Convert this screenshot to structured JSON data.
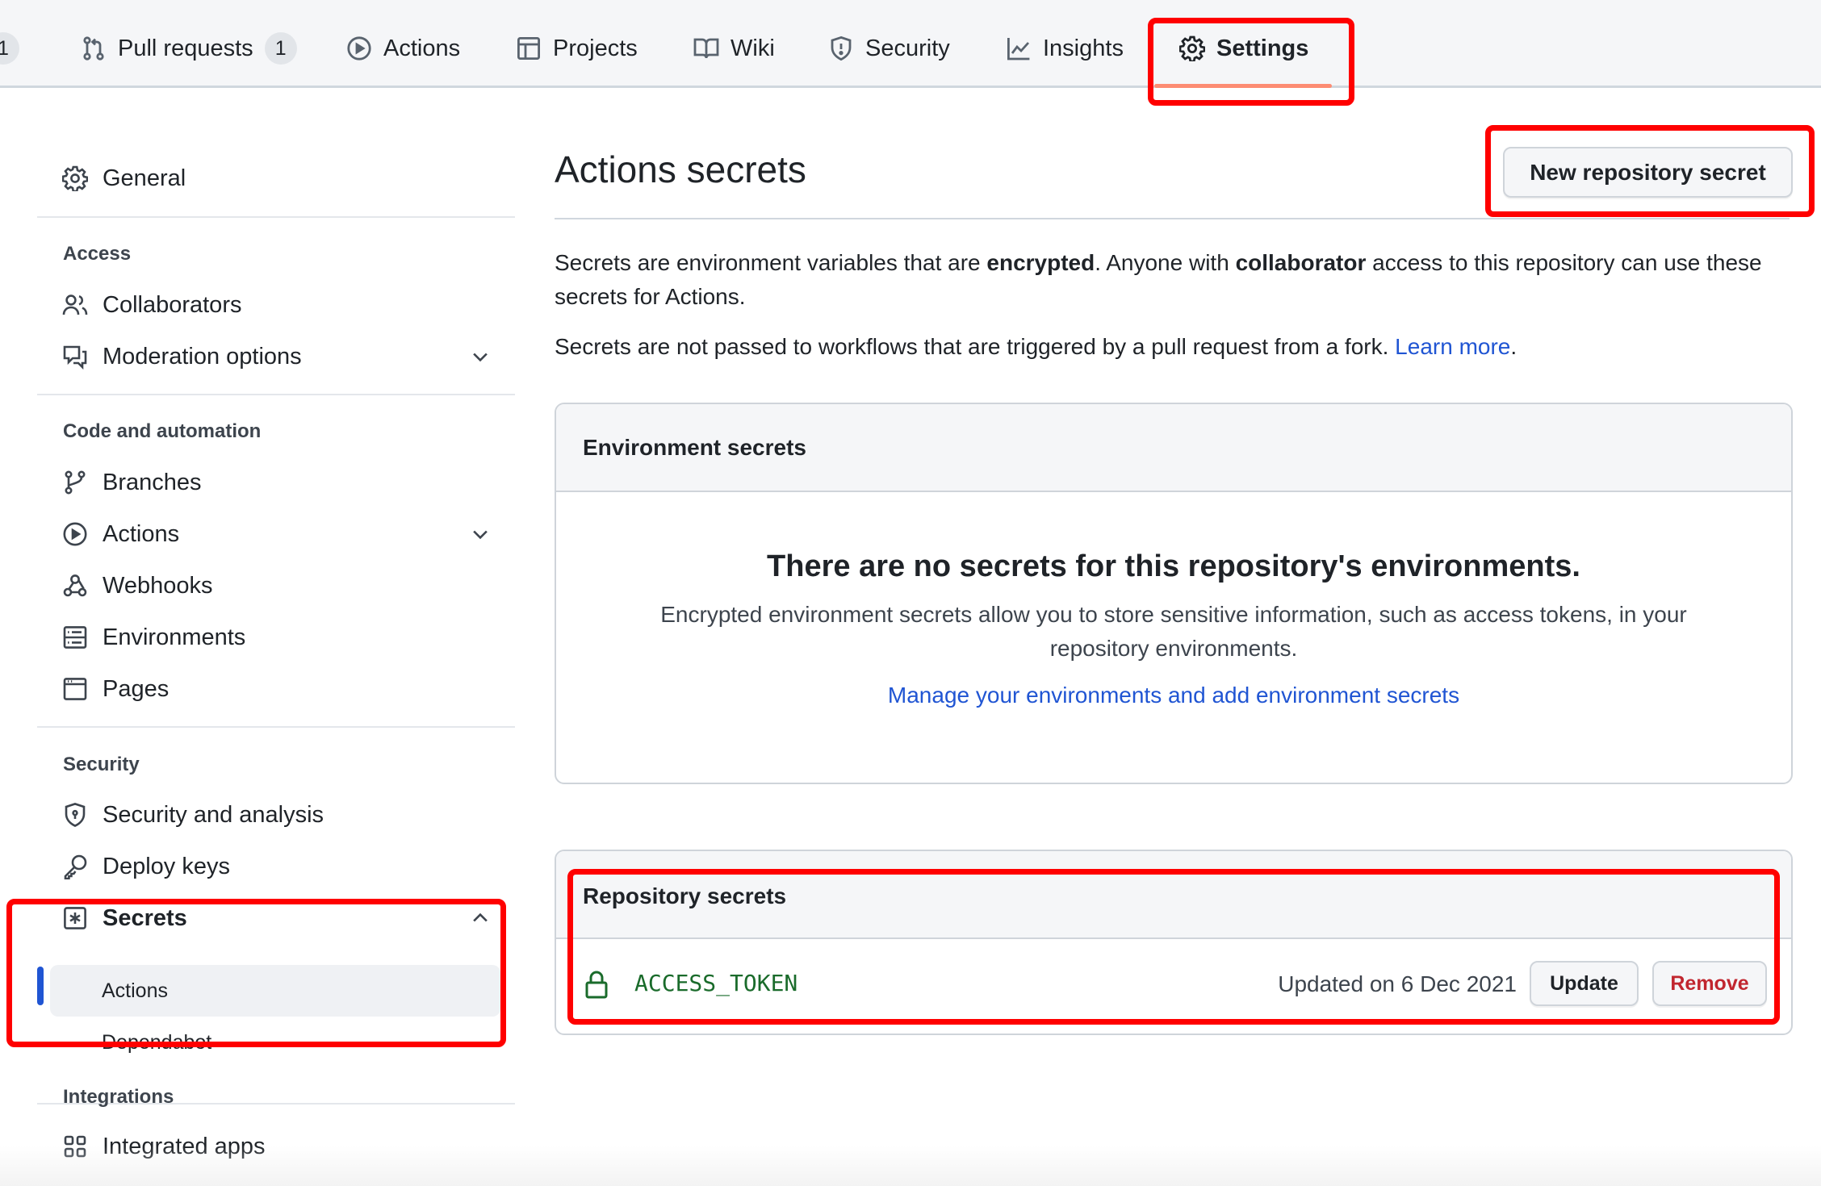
{
  "repo_nav": {
    "tabs": [
      {
        "label": "",
        "icon": "issue-icon",
        "counter": "1"
      },
      {
        "label": "Pull requests",
        "icon": "git-pull-request-icon",
        "counter": "1"
      },
      {
        "label": "Actions",
        "icon": "play-icon",
        "counter": null
      },
      {
        "label": "Projects",
        "icon": "table-icon",
        "counter": null
      },
      {
        "label": "Wiki",
        "icon": "book-icon",
        "counter": null
      },
      {
        "label": "Security",
        "icon": "shield-icon",
        "counter": null
      },
      {
        "label": "Insights",
        "icon": "graph-icon",
        "counter": null
      },
      {
        "label": "Settings",
        "icon": "gear-icon",
        "counter": null,
        "active": true
      }
    ]
  },
  "sidebar": {
    "general": {
      "label": "General",
      "icon": "gear-icon"
    },
    "sections": [
      {
        "heading": "Access",
        "items": [
          {
            "label": "Collaborators",
            "icon": "people-icon"
          },
          {
            "label": "Moderation options",
            "icon": "comment-discussion-icon",
            "expandable": true,
            "expanded": false
          }
        ]
      },
      {
        "heading": "Code and automation",
        "items": [
          {
            "label": "Branches",
            "icon": "git-branch-icon"
          },
          {
            "label": "Actions",
            "icon": "play-icon",
            "expandable": true,
            "expanded": false
          },
          {
            "label": "Webhooks",
            "icon": "webhook-icon"
          },
          {
            "label": "Environments",
            "icon": "server-icon"
          },
          {
            "label": "Pages",
            "icon": "browser-icon"
          }
        ]
      },
      {
        "heading": "Security",
        "items": [
          {
            "label": "Security and analysis",
            "icon": "shield-lock-icon"
          },
          {
            "label": "Deploy keys",
            "icon": "key-icon"
          },
          {
            "label": "Secrets",
            "icon": "key-asterisk-icon",
            "expandable": true,
            "expanded": true,
            "children": [
              {
                "label": "Actions",
                "active": true
              },
              {
                "label": "Dependabot",
                "active": false
              }
            ]
          }
        ]
      },
      {
        "heading": "Integrations",
        "items": [
          {
            "label": "Integrated apps",
            "icon": "apps-icon"
          }
        ]
      }
    ]
  },
  "main": {
    "title": "Actions secrets",
    "new_secret_button": "New repository secret",
    "intro": {
      "part1": "Secrets are environment variables that are ",
      "bold1": "encrypted",
      "part2": ". Anyone with ",
      "bold2": "collaborator",
      "part3": " access to this repository can use these secrets for Actions."
    },
    "fork_note": {
      "text": "Secrets are not passed to workflows that are triggered by a pull request from a fork. ",
      "link": "Learn more",
      "suffix": "."
    },
    "environment_secrets": {
      "title": "Environment secrets",
      "blank_title": "There are no secrets for this repository's environments.",
      "blank_desc": "Encrypted environment secrets allow you to store sensitive information, such as access tokens, in your repository environments.",
      "blank_link": "Manage your environments and add environment secrets"
    },
    "repository_secrets": {
      "title": "Repository secrets",
      "items": [
        {
          "name": "ACCESS_TOKEN",
          "updated": "Updated on 6 Dec 2021",
          "update_label": "Update",
          "remove_label": "Remove"
        }
      ]
    }
  },
  "colors": {
    "accent_link": "#2055d3",
    "active_tab_underline": "#fd8c73",
    "secret_name": "#1a6b2b",
    "danger": "#c1262f",
    "annotation": "#ff0000"
  }
}
